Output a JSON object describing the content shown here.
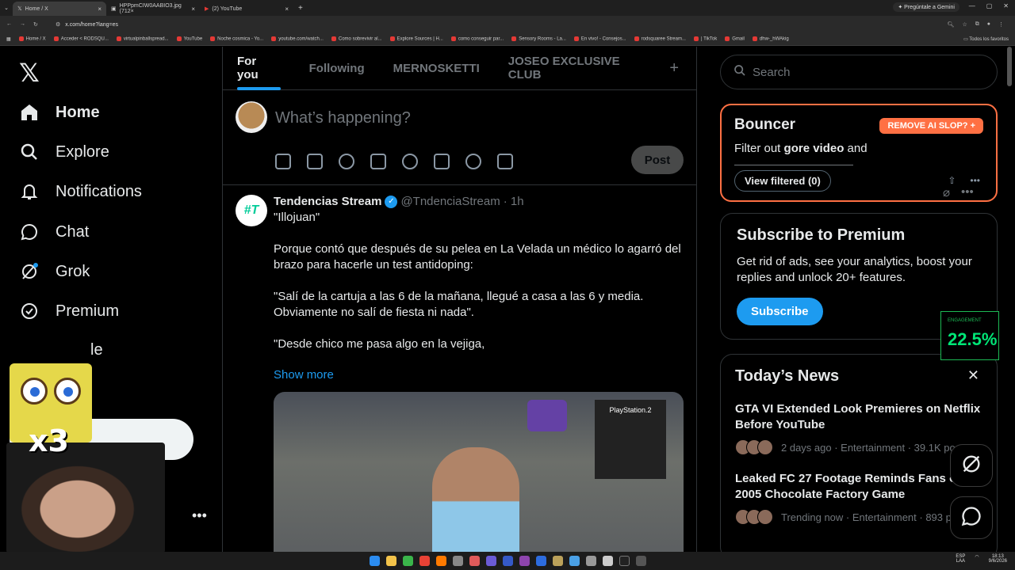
{
  "browser": {
    "tabs": [
      {
        "label": "Home / X"
      },
      {
        "label": "HPPpmCIW0AABIO3.jpg (712×"
      },
      {
        "label": "(2) YouTube"
      }
    ],
    "gemini_label": "Pregúntale a Gemini",
    "url": "x.com/home?lang=es",
    "bookmarks": [
      "Home / X",
      "Acceder < RODSQU...",
      "virtualpinballspread...",
      "YouTube",
      "Noche cosmica - Yo...",
      "youtube.com/watch...",
      "Como sobrevivir al...",
      "Explore Sources | H...",
      "como conseguir par...",
      "Sensory Rooms - La...",
      "En vivo! - Consejos...",
      "rodsquaree Stream...",
      "| TikTok",
      "Gmail",
      "dhw-_hWAkig",
      "Todos los favoritos"
    ]
  },
  "nav": {
    "items": [
      {
        "label": "Home"
      },
      {
        "label": "Explore"
      },
      {
        "label": "Notifications"
      },
      {
        "label": "Chat"
      },
      {
        "label": "Grok"
      },
      {
        "label": "Premium"
      },
      {
        "label": "le"
      }
    ],
    "overlay_text": "x3"
  },
  "feed": {
    "tabs": [
      "For you",
      "Following",
      "MERNOSKETTI",
      "JOSEO EXCLUSIVE CLUB"
    ],
    "composer_placeholder": "What’s happening?",
    "post_label": "Post",
    "tweet": {
      "avatar_text": "#T",
      "name": "Tendencias Stream",
      "handle": "@TndenciaStream",
      "time": "· 1h",
      "paragraphs": [
        "\"Illojuan\"",
        "Porque contó que después de su pelea en La Velada un médico lo agarró del brazo para hacerle un test antidoping:",
        "\"Salí de la cartuja a las 6 de la mañana, llegué a casa a las 6 y media. Obviamente no salí de fiesta ni nada\".",
        "\"Desde chico me pasa algo en la vejiga,"
      ],
      "show_more": "Show more",
      "media_text": "PlayStation.2"
    }
  },
  "sidebar": {
    "search_placeholder": "Search",
    "bouncer": {
      "title": "Bouncer",
      "remove_label": "REMOVE AI SLOP?",
      "filter_prefix": "Filter out ",
      "filter_bold": "gore video",
      "filter_suffix": " and",
      "view_filtered": "View filtered (0)"
    },
    "premium": {
      "title": "Subscribe to Premium",
      "text": "Get rid of ads, see your analytics, boost your replies and unlock 20+ features.",
      "button": "Subscribe"
    },
    "engagement": {
      "label": "ENGAGEMENT",
      "value": "22.5%"
    },
    "news": {
      "title": "Today’s News",
      "items": [
        {
          "title": "GTA VI Extended Look Premieres on Netflix Before YouTube",
          "meta": "2 days ago · Entertainment · 39.1K po"
        },
        {
          "title": "Leaked FC 27 Footage Reminds Fans of 2005 Chocolate Factory Game",
          "meta": "Trending now · Entertainment · 893 po"
        }
      ]
    }
  },
  "taskbar": {
    "lang": "ESP\nLAA",
    "time": "18:13",
    "date": "9/6/2026"
  },
  "colors": {
    "accent": "#1d9bf0",
    "bouncer": "#ff7043",
    "engagement": "#00e676"
  }
}
